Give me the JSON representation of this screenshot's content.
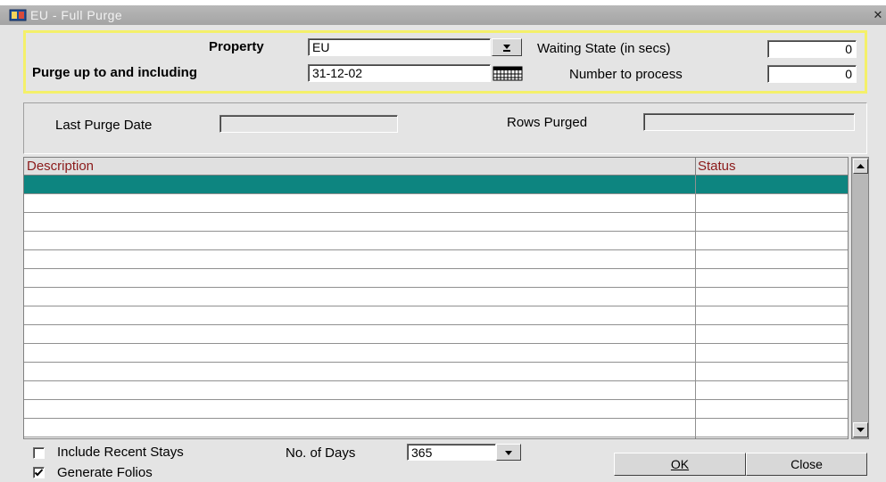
{
  "window": {
    "title": "EU - Full Purge"
  },
  "form": {
    "property_label": "Property",
    "property_value": "EU",
    "purge_label": "Purge up to and including",
    "purge_value": "31-12-02",
    "waiting_label": "Waiting State (in secs)",
    "waiting_value": "0",
    "number_label": "Number to process",
    "number_value": "0"
  },
  "purge_info": {
    "last_purge_label": "Last Purge Date",
    "last_purge_value": "",
    "rows_purged_label": "Rows Purged",
    "rows_purged_value": ""
  },
  "grid": {
    "columns": [
      "Description",
      "Status"
    ],
    "rows": [
      {
        "description": "",
        "status": ""
      },
      {
        "description": "",
        "status": ""
      },
      {
        "description": "",
        "status": ""
      },
      {
        "description": "",
        "status": ""
      },
      {
        "description": "",
        "status": ""
      },
      {
        "description": "",
        "status": ""
      },
      {
        "description": "",
        "status": ""
      },
      {
        "description": "",
        "status": ""
      },
      {
        "description": "",
        "status": ""
      },
      {
        "description": "",
        "status": ""
      },
      {
        "description": "",
        "status": ""
      },
      {
        "description": "",
        "status": ""
      },
      {
        "description": "",
        "status": ""
      },
      {
        "description": "",
        "status": ""
      }
    ],
    "selected_row": 0,
    "selected_color": "#0d8580"
  },
  "options": {
    "include_recent_label": "Include Recent Stays",
    "include_recent_checked": false,
    "days_label": "No. of Days",
    "days_value": "365",
    "generate_folios_label": "Generate Folios",
    "generate_folios_checked": true
  },
  "buttons": {
    "ok": "OK",
    "close": "Close"
  },
  "colors": {
    "highlight_border": "#f4f06a",
    "header_text": "#8b1a1a",
    "selected_row": "#0d8580"
  }
}
